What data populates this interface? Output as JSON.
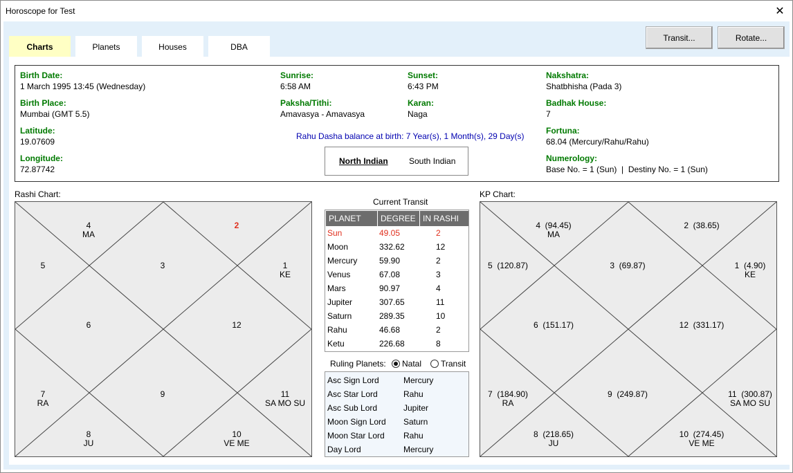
{
  "window": {
    "title": "Horoscope for Test",
    "close_glyph": "✕"
  },
  "tabs": [
    {
      "label": "Charts",
      "active": true
    },
    {
      "label": "Planets",
      "active": false
    },
    {
      "label": "Houses",
      "active": false
    },
    {
      "label": "DBA",
      "active": false
    }
  ],
  "toolbar": {
    "transit_label": "Transit...",
    "rotate_label": "Rotate..."
  },
  "info": {
    "birth_date": {
      "label": "Birth Date:",
      "value": "1 March 1995 13:45 (Wednesday)"
    },
    "birth_place": {
      "label": "Birth Place:",
      "value": "Mumbai (GMT 5.5)"
    },
    "latitude": {
      "label": "Latitude:",
      "value": "19.07609"
    },
    "longitude": {
      "label": "Longitude:",
      "value": "72.87742"
    },
    "sunrise": {
      "label": "Sunrise:",
      "value": "6:58 AM"
    },
    "paksha": {
      "label": "Paksha/Tithi:",
      "value": "Amavasya - Amavasya"
    },
    "sunset": {
      "label": "Sunset:",
      "value": "6:43 PM"
    },
    "karan": {
      "label": "Karan:",
      "value": "Naga"
    },
    "nakshatra": {
      "label": "Nakshatra:",
      "value": "Shatbhisha (Pada 3)"
    },
    "badhak": {
      "label": "Badhak House:",
      "value": "7"
    },
    "fortuna": {
      "label": "Fortuna:",
      "value": "68.04 (Mercury/Rahu/Rahu)"
    },
    "numerology": {
      "label": "Numerology:",
      "value": "Base No. = 1 (Sun)  |  Destiny No. = 1 (Sun)"
    },
    "dasha_balance": "Rahu Dasha balance at birth: 7 Year(s), 1 Month(s), 29 Day(s)"
  },
  "chart_style": {
    "north_indian": "North Indian",
    "south_indian": "South Indian",
    "selected": "North Indian"
  },
  "rashi_chart": {
    "caption": "Rashi Chart:",
    "highlight_color": "#e0301e",
    "houses": [
      {
        "sign": "4",
        "planets": "MA",
        "highlight": false
      },
      {
        "sign": "2",
        "planets": "",
        "highlight": true
      },
      {
        "sign": "5",
        "planets": "",
        "highlight": false
      },
      {
        "sign": "3",
        "planets": "",
        "highlight": false
      },
      {
        "sign": "1",
        "planets": "KE",
        "highlight": false
      },
      {
        "sign": "6",
        "planets": "",
        "highlight": false
      },
      {
        "sign": "12",
        "planets": "",
        "highlight": false
      },
      {
        "sign": "7",
        "planets": "RA",
        "highlight": false
      },
      {
        "sign": "9",
        "planets": "",
        "highlight": false
      },
      {
        "sign": "11",
        "planets": "SA MO SU",
        "highlight": false
      },
      {
        "sign": "8",
        "planets": "JU",
        "highlight": false
      },
      {
        "sign": "10",
        "planets": "VE ME",
        "highlight": false
      }
    ]
  },
  "kp_chart": {
    "caption": "KP Chart:",
    "houses": [
      {
        "label": "4  (94.45)",
        "planets": "MA"
      },
      {
        "label": "2  (38.65)",
        "planets": ""
      },
      {
        "label": "5  (120.87)",
        "planets": ""
      },
      {
        "label": "3  (69.87)",
        "planets": ""
      },
      {
        "label": "1  (4.90)",
        "planets": "KE"
      },
      {
        "label": "6  (151.17)",
        "planets": ""
      },
      {
        "label": "12  (331.17)",
        "planets": ""
      },
      {
        "label": "7  (184.90)",
        "planets": "RA"
      },
      {
        "label": "9  (249.87)",
        "planets": ""
      },
      {
        "label": "11  (300.87)",
        "planets": "SA MO SU"
      },
      {
        "label": "8  (218.65)",
        "planets": "JU"
      },
      {
        "label": "10  (274.45)",
        "planets": "VE ME"
      }
    ]
  },
  "transit": {
    "caption": "Current Transit",
    "headers": [
      "PLANET",
      "DEGREE",
      "IN RASHI"
    ],
    "highlight_color": "#e0301e",
    "rows": [
      {
        "planet": "Sun",
        "degree": "49.05",
        "rashi": "2",
        "highlight": true
      },
      {
        "planet": "Moon",
        "degree": "332.62",
        "rashi": "12",
        "highlight": false
      },
      {
        "planet": "Mercury",
        "degree": "59.90",
        "rashi": "2",
        "highlight": false
      },
      {
        "planet": "Venus",
        "degree": "67.08",
        "rashi": "3",
        "highlight": false
      },
      {
        "planet": "Mars",
        "degree": "90.97",
        "rashi": "4",
        "highlight": false
      },
      {
        "planet": "Jupiter",
        "degree": "307.65",
        "rashi": "11",
        "highlight": false
      },
      {
        "planet": "Saturn",
        "degree": "289.35",
        "rashi": "10",
        "highlight": false
      },
      {
        "planet": "Rahu",
        "degree": "46.68",
        "rashi": "2",
        "highlight": false
      },
      {
        "planet": "Ketu",
        "degree": "226.68",
        "rashi": "8",
        "highlight": false
      }
    ]
  },
  "ruling": {
    "caption": "Ruling Planets:",
    "natal_label": "Natal",
    "transit_label": "Transit",
    "selected": "Natal",
    "rows": [
      {
        "name": "Asc Sign Lord",
        "value": "Mercury"
      },
      {
        "name": "Asc Star Lord",
        "value": "Rahu"
      },
      {
        "name": "Asc Sub Lord",
        "value": "Jupiter"
      },
      {
        "name": "Moon Sign Lord",
        "value": "Saturn"
      },
      {
        "name": "Moon Star Lord",
        "value": "Rahu"
      },
      {
        "name": "Day Lord",
        "value": "Mercury"
      }
    ]
  }
}
